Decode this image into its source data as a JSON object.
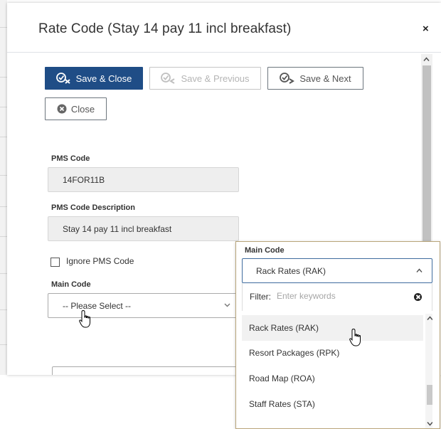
{
  "modal": {
    "title": "Rate Code (Stay 14 pay 11 incl breakfast)",
    "close_symbol": "×"
  },
  "toolbar": {
    "save_close": "Save & Close",
    "save_previous": "Save & Previous",
    "save_next": "Save & Next",
    "close": "Close"
  },
  "form": {
    "pms_code_label": "PMS Code",
    "pms_code_value": "14FOR11B",
    "pms_desc_label": "PMS Code Description",
    "pms_desc_value": "Stay 14 pay 11 incl breakfast",
    "ignore_label": "Ignore PMS Code",
    "ignore_checked": false,
    "main_code_label": "Main Code",
    "main_code_placeholder": "-- Please Select --"
  },
  "dropdown": {
    "label": "Main Code",
    "selected": "Rack Rates (RAK)",
    "filter_label": "Filter:",
    "filter_placeholder": "Enter keywords",
    "options": [
      {
        "label": "Rack Rates (RAK)",
        "hovered": true
      },
      {
        "label": "Resort Packages (RPK)",
        "hovered": false
      },
      {
        "label": "Road Map (ROA)",
        "hovered": false
      },
      {
        "label": "Staff Rates (STA)",
        "hovered": false
      }
    ]
  },
  "colors": {
    "primary": "#1f4d86",
    "dropdown_border": "#b9a57a",
    "focus_border": "#3f6c9e"
  },
  "icons": {
    "save_close": "check-x-icon",
    "save_previous": "check-arrow-left-icon",
    "save_next": "check-arrow-right-icon",
    "close": "circle-x-icon",
    "cursor": "hand-pointer-icon"
  }
}
